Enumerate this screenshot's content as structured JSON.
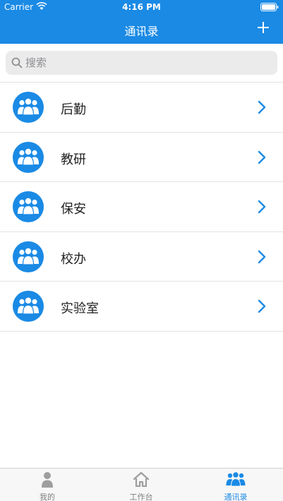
{
  "status_bar": {
    "carrier": "Carrier",
    "time": "4:16 PM"
  },
  "nav": {
    "title": "通讯录",
    "add_icon": "plus-icon"
  },
  "search": {
    "placeholder": "搜索",
    "value": ""
  },
  "contacts": [
    {
      "label": "后勤"
    },
    {
      "label": "教研"
    },
    {
      "label": "保安"
    },
    {
      "label": "校办"
    },
    {
      "label": "实验室"
    }
  ],
  "tabs": [
    {
      "label": "我的",
      "icon": "person-icon",
      "active": false
    },
    {
      "label": "工作台",
      "icon": "home-icon",
      "active": false
    },
    {
      "label": "通讯录",
      "icon": "group-icon",
      "active": true
    }
  ],
  "colors": {
    "primary": "#1a8ae5",
    "tab_inactive": "#7f7f7f"
  }
}
